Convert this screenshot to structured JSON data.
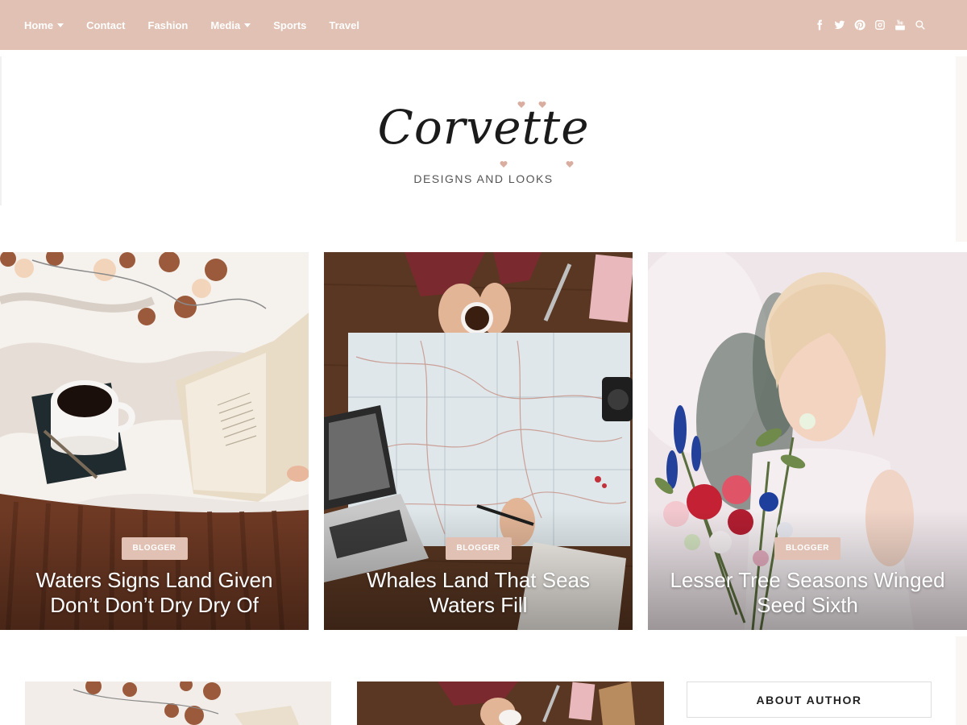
{
  "nav": {
    "items": [
      {
        "label": "Home",
        "dropdown": true
      },
      {
        "label": "Contact",
        "dropdown": false
      },
      {
        "label": "Fashion",
        "dropdown": false
      },
      {
        "label": "Media",
        "dropdown": true
      },
      {
        "label": "Sports",
        "dropdown": false
      },
      {
        "label": "Travel",
        "dropdown": false
      }
    ],
    "social_icons": [
      "facebook-icon",
      "twitter-icon",
      "pinterest-icon",
      "instagram-icon",
      "youtube-icon",
      "search-icon"
    ]
  },
  "logo": {
    "title": "Corvette",
    "tagline": "DESIGNS AND LOOKS"
  },
  "slider": [
    {
      "badge": "BLOGGER",
      "title": "Waters Signs Land Given Don’t Don’t Dry Dry Of"
    },
    {
      "badge": "BLOGGER",
      "title": "Whales Land That Seas Waters Fill"
    },
    {
      "badge": "BLOGGER",
      "title": "Lesser Tree Seasons Winged Seed Sixth"
    }
  ],
  "sidebar": {
    "about_title": "ABOUT AUTHOR"
  },
  "colors": {
    "accent": "#e1c1b3",
    "heart": "#d9ada0",
    "text_dark": "#1b1b1b"
  }
}
